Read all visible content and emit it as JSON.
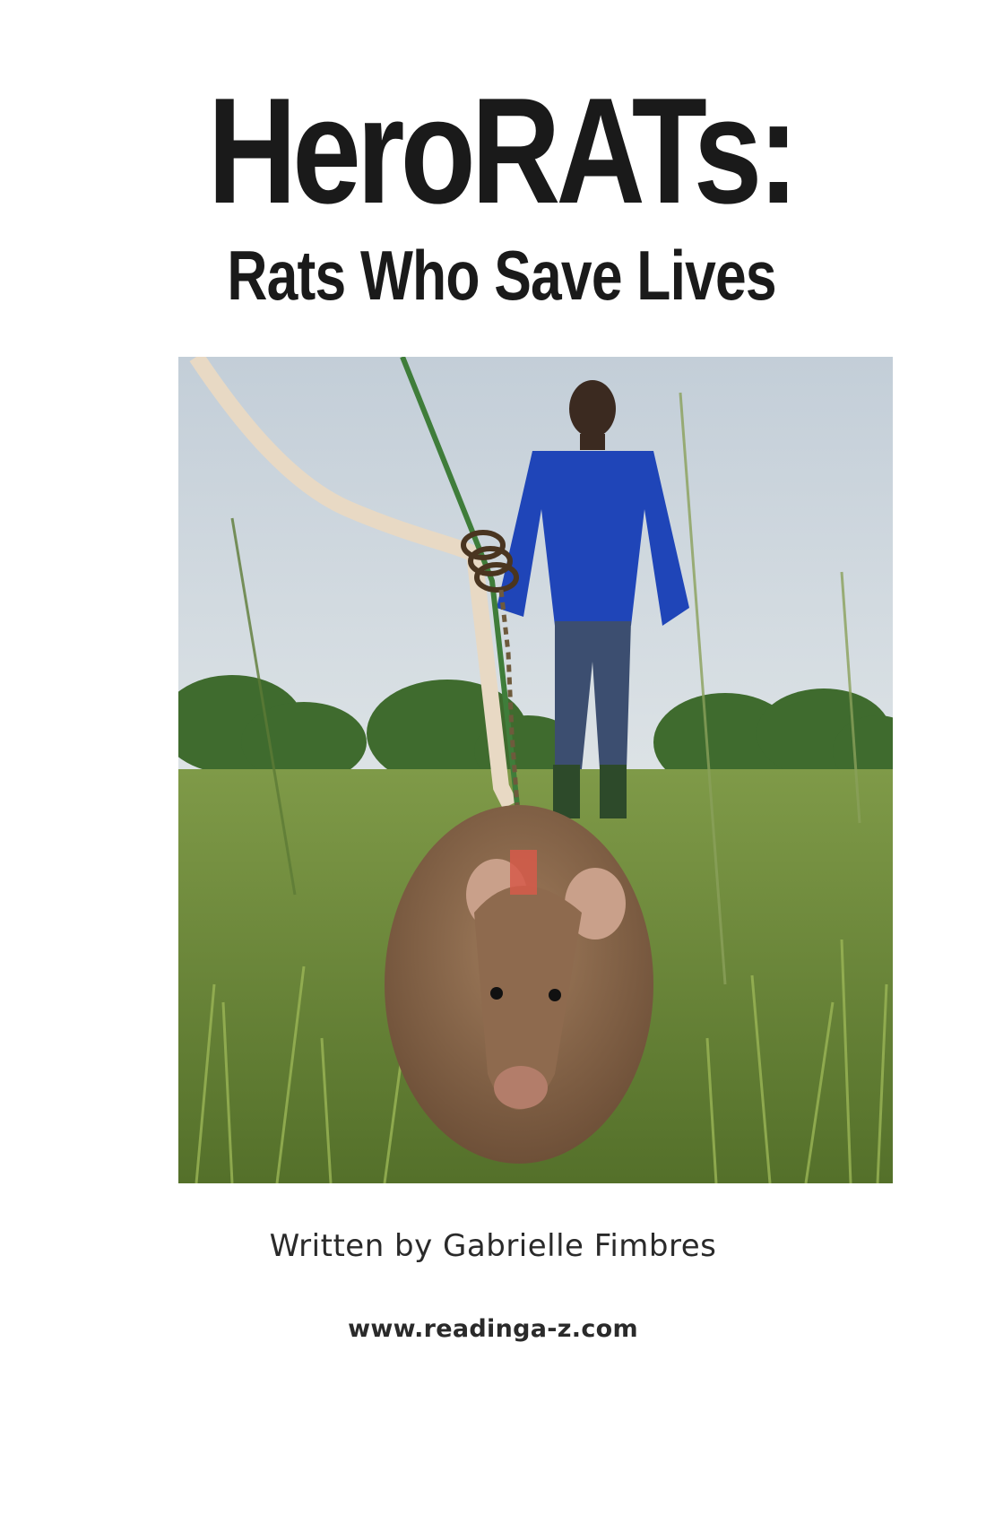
{
  "cover": {
    "title": "HeroRATs:",
    "subtitle": "Rats Who Save Lives",
    "photo": {
      "subject": "rat-on-leash-with-handler-photo"
    },
    "byline": "Written by Gabrielle Fimbres",
    "url": "www.readinga-z.com"
  },
  "colors": {
    "title": "#1a1a1a",
    "sky": "#c9d3dc",
    "grass": "#6b8a3a",
    "jacket": "#1f45b8",
    "rat": "#8a6a4e"
  }
}
